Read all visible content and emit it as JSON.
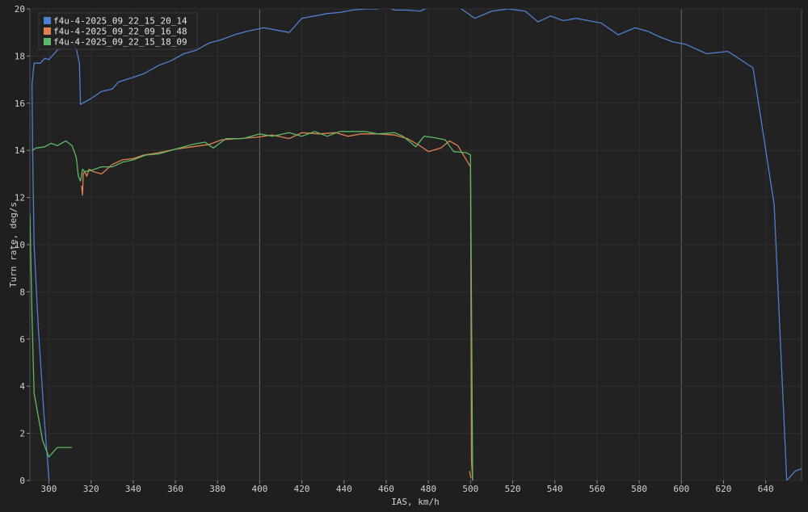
{
  "chart_data": {
    "type": "line",
    "xlabel": "IAS, km/h",
    "ylabel": "Turn rate, deg/s",
    "xlim": [
      291,
      657
    ],
    "ylim": [
      0,
      20
    ],
    "x_ticks": [
      300,
      320,
      340,
      360,
      380,
      400,
      420,
      440,
      460,
      480,
      500,
      520,
      540,
      560,
      580,
      600,
      620,
      640
    ],
    "y_ticks": [
      0,
      2,
      4,
      6,
      8,
      10,
      12,
      14,
      16,
      18,
      20
    ],
    "major_x": [
      400,
      600
    ],
    "grid": true,
    "legend_position": "top-left",
    "series": [
      {
        "name": "f4u-4-2025_09_22_15_20_14",
        "color": "#4f7fd0",
        "segments": [
          [
            [
              300.1,
              0
            ],
            [
              297.5,
              3
            ],
            [
              295,
              6.5
            ],
            [
              293,
              10
            ],
            [
              292.3,
              14
            ],
            [
              292,
              16.8
            ],
            [
              293,
              17.7
            ],
            [
              296,
              17.7
            ],
            [
              298,
              17.9
            ],
            [
              300,
              17.85
            ],
            [
              301.5,
              18
            ],
            [
              304,
              18.25
            ],
            [
              308,
              18.4
            ],
            [
              311,
              18.55
            ],
            [
              313,
              18.3
            ],
            [
              314.5,
              17.7
            ],
            [
              315,
              15.95
            ],
            [
              320,
              16.2
            ],
            [
              325,
              16.5
            ],
            [
              330,
              16.6
            ],
            [
              333,
              16.9
            ],
            [
              340,
              17.1
            ],
            [
              345,
              17.25
            ],
            [
              352,
              17.6
            ],
            [
              358,
              17.8
            ],
            [
              364,
              18.1
            ],
            [
              370,
              18.25
            ],
            [
              376,
              18.55
            ],
            [
              382,
              18.7
            ],
            [
              388,
              18.9
            ],
            [
              394,
              19.05
            ],
            [
              402,
              19.2
            ],
            [
              408,
              19.1
            ],
            [
              414,
              19
            ],
            [
              420,
              19.6
            ],
            [
              426,
              19.7
            ],
            [
              432,
              19.8
            ],
            [
              438,
              19.85
            ],
            [
              444,
              19.95
            ],
            [
              450,
              20
            ],
            [
              456,
              20
            ],
            [
              460,
              20.1
            ],
            [
              464,
              19.95
            ],
            [
              470,
              19.95
            ],
            [
              476,
              19.9
            ],
            [
              481,
              20.1
            ]
          ],
          [
            [
              494,
              20.1
            ],
            [
              502,
              19.6
            ],
            [
              510,
              19.9
            ],
            [
              518,
              20
            ],
            [
              526,
              19.9
            ],
            [
              532,
              19.45
            ],
            [
              538,
              19.7
            ],
            [
              544,
              19.5
            ],
            [
              550,
              19.6
            ],
            [
              556,
              19.5
            ],
            [
              562,
              19.4
            ],
            [
              570,
              18.9
            ],
            [
              578,
              19.2
            ],
            [
              584,
              19.05
            ],
            [
              590,
              18.8
            ],
            [
              596,
              18.6
            ],
            [
              602,
              18.5
            ],
            [
              612,
              18.1
            ],
            [
              622,
              18.2
            ],
            [
              634,
              17.5
            ],
            [
              644,
              11.7
            ],
            [
              650,
              0
            ],
            [
              654,
              0.4
            ],
            [
              657,
              0.5
            ]
          ]
        ]
      },
      {
        "name": "f4u-4-2025_09_22_09_16_48",
        "color": "#e0804f",
        "segments": [
          [
            [
              315.5,
              12.5
            ],
            [
              316,
              12.1
            ],
            [
              316.3,
              13
            ],
            [
              317,
              13.1
            ],
            [
              318,
              12.9
            ],
            [
              319,
              13.2
            ],
            [
              321,
              13.1
            ],
            [
              325,
              13
            ],
            [
              330,
              13.4
            ],
            [
              335,
              13.6
            ],
            [
              340,
              13.65
            ],
            [
              345,
              13.8
            ],
            [
              352,
              13.9
            ],
            [
              360,
              14.05
            ],
            [
              368,
              14.15
            ],
            [
              376,
              14.25
            ],
            [
              382,
              14.45
            ],
            [
              390,
              14.5
            ],
            [
              398,
              14.55
            ],
            [
              406,
              14.65
            ],
            [
              414,
              14.5
            ],
            [
              420,
              14.75
            ],
            [
              428,
              14.7
            ],
            [
              436,
              14.75
            ],
            [
              442,
              14.6
            ],
            [
              448,
              14.7
            ],
            [
              456,
              14.7
            ],
            [
              464,
              14.65
            ],
            [
              470,
              14.5
            ],
            [
              476,
              14.2
            ],
            [
              480,
              13.95
            ],
            [
              486,
              14.1
            ],
            [
              490,
              14.4
            ],
            [
              494,
              14.2
            ],
            [
              498,
              13.6
            ],
            [
              500,
              13.3
            ],
            [
              500.5,
              0.8
            ],
            [
              501,
              0
            ]
          ],
          [
            [
              499.5,
              0.4
            ],
            [
              500.2,
              0.1
            ]
          ]
        ]
      },
      {
        "name": "f4u-4-2025_09_22_15_18_09",
        "color": "#5cb866",
        "segments": [
          [
            [
              291,
              11.3
            ],
            [
              292,
              7
            ],
            [
              293,
              3.7
            ],
            [
              297,
              1.7
            ],
            [
              300,
              1
            ],
            [
              304,
              1.4
            ],
            [
              311,
              1.4
            ]
          ],
          [
            [
              292,
              14
            ],
            [
              294,
              14.1
            ],
            [
              298,
              14.15
            ],
            [
              301,
              14.3
            ],
            [
              304,
              14.2
            ],
            [
              308,
              14.4
            ],
            [
              311,
              14.2
            ],
            [
              313,
              13.7
            ],
            [
              314,
              12.9
            ],
            [
              315,
              12.7
            ],
            [
              316,
              13.2
            ],
            [
              317,
              13.1
            ],
            [
              320,
              13.15
            ],
            [
              325,
              13.3
            ],
            [
              330,
              13.3
            ],
            [
              335,
              13.5
            ],
            [
              340,
              13.6
            ],
            [
              346,
              13.8
            ],
            [
              352,
              13.85
            ],
            [
              360,
              14.05
            ],
            [
              368,
              14.25
            ],
            [
              374,
              14.35
            ],
            [
              378,
              14.1
            ],
            [
              384,
              14.5
            ],
            [
              392,
              14.5
            ],
            [
              400,
              14.7
            ],
            [
              406,
              14.6
            ],
            [
              414,
              14.75
            ],
            [
              420,
              14.6
            ],
            [
              426,
              14.8
            ],
            [
              432,
              14.6
            ],
            [
              438,
              14.8
            ],
            [
              444,
              14.8
            ],
            [
              450,
              14.8
            ],
            [
              456,
              14.7
            ],
            [
              464,
              14.75
            ],
            [
              468,
              14.6
            ],
            [
              474,
              14.15
            ],
            [
              478,
              14.6
            ],
            [
              482,
              14.55
            ],
            [
              488,
              14.45
            ],
            [
              492,
              13.95
            ],
            [
              498,
              13.9
            ],
            [
              500,
              13.8
            ],
            [
              501,
              0
            ]
          ]
        ]
      }
    ]
  }
}
